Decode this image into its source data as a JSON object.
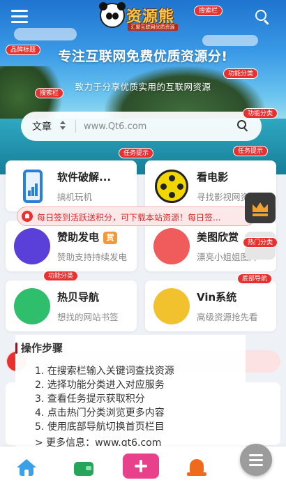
{
  "header": {
    "logo_text": "资源熊",
    "logo_slogan": "汇聚互联网优质资源"
  },
  "tags": {
    "search_bar_top": "搜索栏",
    "brand_title": "品牌标题",
    "feature_category_1": "功能分类",
    "search_bar_left": "搜索栏",
    "feature_category_2": "功能分类",
    "task_hint_1": "任务提示",
    "task_hint_2": "任务提示",
    "hot_category": "热门分类",
    "feature_category_3": "功能分类",
    "bottom_nav": "底部导航"
  },
  "hero": {
    "title": "专注互联网免费优质资源分!",
    "subtitle": "致力于分享优质实用的互联网资源"
  },
  "search": {
    "category": "文章",
    "placeholder": "www.Qt6.com"
  },
  "cards": [
    {
      "title": "软件破解...",
      "desc": "搞机玩机",
      "icon": "phone-chart-icon"
    },
    {
      "title": "看电影",
      "desc": "寻找影视网资源",
      "icon": "film-reel-icon"
    },
    {
      "title": "赞助发电",
      "badge": "赏",
      "desc": "赞助支持持续发电",
      "icon": "money-bag-icon"
    },
    {
      "title": "美图欣赏",
      "desc": "漂亮小姐姐图片",
      "icon": "heart-pulse-icon"
    },
    {
      "title": "热贝导航",
      "desc": "想找的网站书签",
      "icon": "gift-icon"
    },
    {
      "title": "Vin系统",
      "desc": "高级资源抢先看",
      "icon": "vip-crown-icon"
    }
  ],
  "notice": {
    "text": "每日签到活跃送积分，可下载本站资源！每日签..."
  },
  "steps": {
    "heading": "操作步骤",
    "items": [
      "1. 在搜索栏输入关键词查找资源",
      "2. 选择功能分类进入对应服务",
      "3. 查看任务提示获取积分",
      "4. 点击热门分类浏览更多内容",
      "5. 使用底部导航切换首页栏目"
    ],
    "more": "> 更多信息：www.qt6.com"
  },
  "colors": {
    "tag_red": "#e8312f",
    "hero_blue": "#1f74cf",
    "plus_pink": "#e8408a"
  }
}
